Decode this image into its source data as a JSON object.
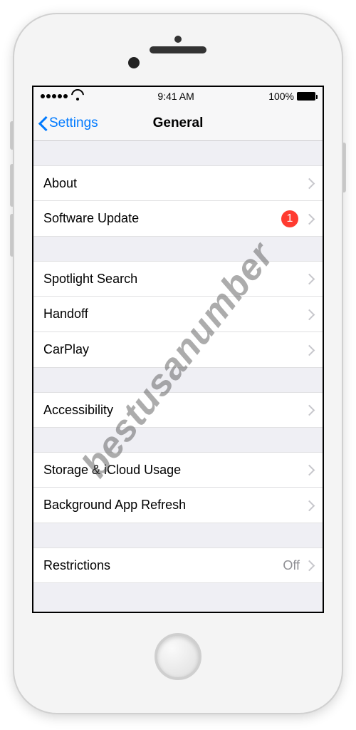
{
  "status": {
    "time": "9:41 AM",
    "battery_pct": "100%"
  },
  "nav": {
    "back_label": "Settings",
    "title": "General"
  },
  "rows": {
    "about": "About",
    "software_update": "Software Update",
    "software_update_badge": "1",
    "spotlight": "Spotlight Search",
    "handoff": "Handoff",
    "carplay": "CarPlay",
    "accessibility": "Accessibility",
    "storage": "Storage & iCloud Usage",
    "background_refresh": "Background App Refresh",
    "restrictions": "Restrictions",
    "restrictions_value": "Off"
  },
  "watermark": "bestusanumber"
}
